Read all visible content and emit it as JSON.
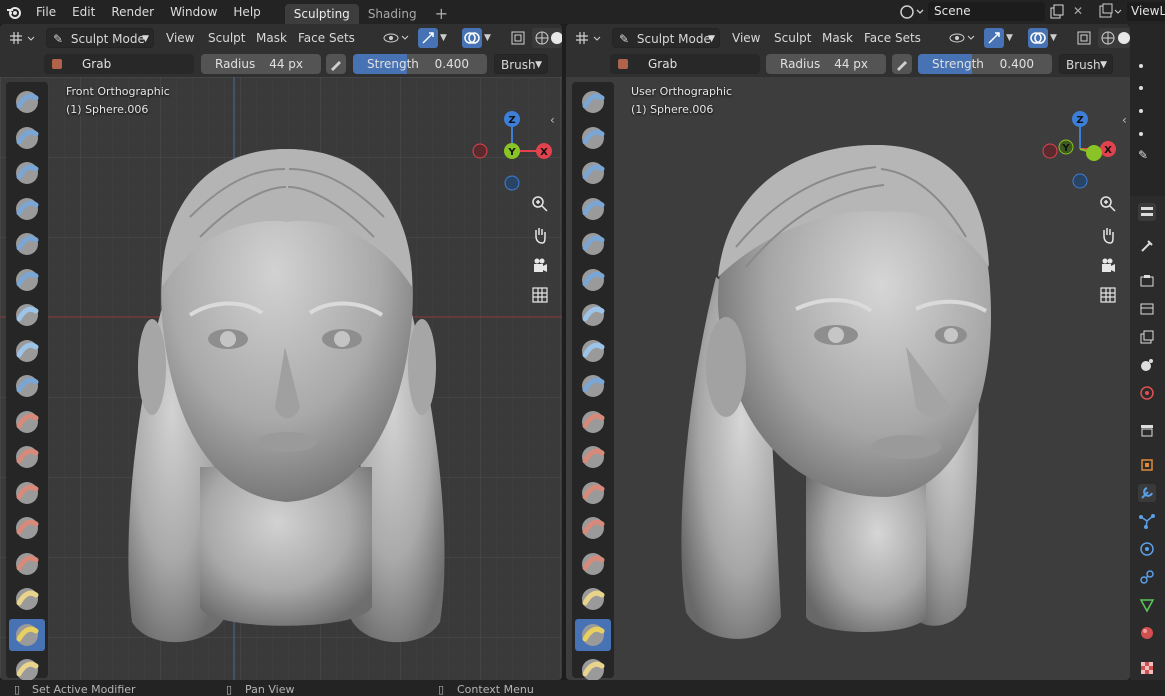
{
  "menu": [
    "File",
    "Edit",
    "Render",
    "Window",
    "Help"
  ],
  "workspaces": {
    "active": "Sculpting",
    "other": "Shading",
    "add_icon": "plus-icon"
  },
  "scene": {
    "label": "Scene",
    "viewlayer": "ViewLa"
  },
  "left": {
    "mode": "Sculpt Mode",
    "menus": [
      "View",
      "Sculpt",
      "Mask",
      "Face Sets"
    ],
    "brush_name": "Grab",
    "radius_label": "Radius",
    "radius_value": "44 px",
    "strength_label": "Strength",
    "strength_value": "0.400",
    "strength_fraction": 0.4,
    "brush_menu": "Brush",
    "view_name": "Front Orthographic",
    "object_name": "(1) Sphere.006"
  },
  "right": {
    "mode": "Sculpt Mode",
    "menus": [
      "View",
      "Sculpt",
      "Mask",
      "Face Sets"
    ],
    "brush_name": "Grab",
    "radius_label": "Radius",
    "radius_value": "44 px",
    "strength_label": "Strength",
    "strength_value": "0.400",
    "strength_fraction": 0.4,
    "brush_menu": "Brush",
    "view_name": "User Orthographic",
    "object_name": "(1) Sphere.006"
  },
  "gizmo": {
    "z": "Z",
    "y": "Y",
    "x": "X"
  },
  "statusbar": {
    "left": "Set Active Modifier",
    "middle": "Pan View",
    "right": "Context Menu"
  },
  "colors": {
    "accent": "#4772b3",
    "x_axis": "#e0434e",
    "y_axis": "#8ac325",
    "z_axis": "#3d7fd8"
  }
}
